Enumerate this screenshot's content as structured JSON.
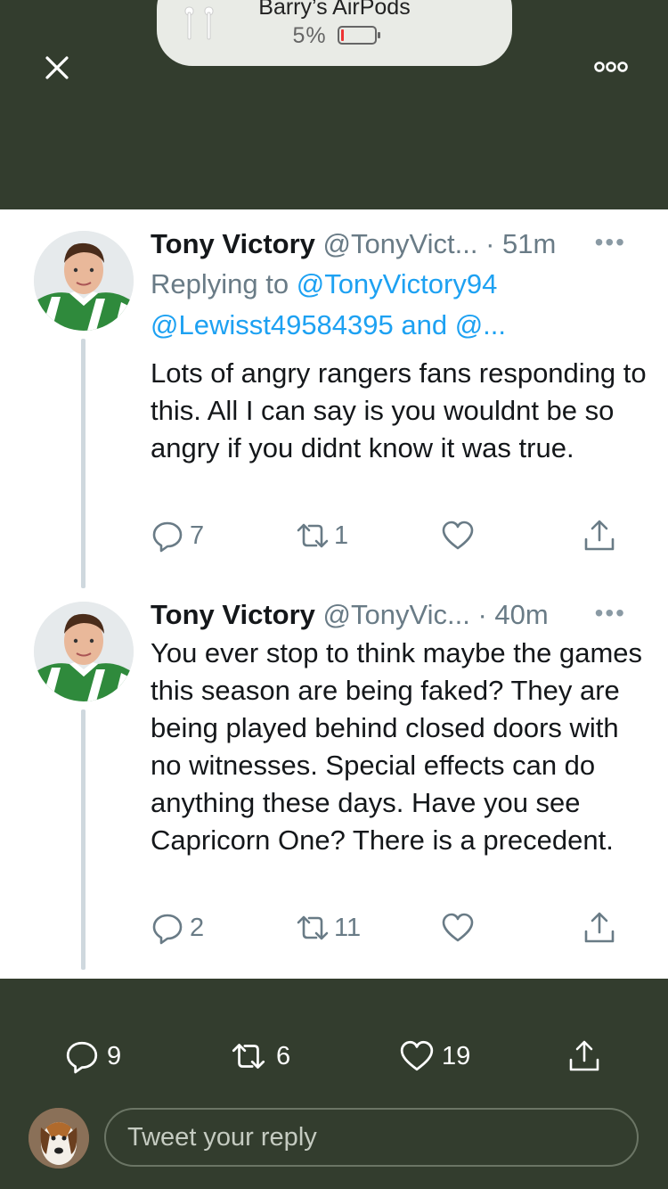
{
  "airpods": {
    "name": "Barry’s AirPods",
    "battery": "5%",
    "battery_level": 0.05
  },
  "tweets": [
    {
      "name": "Tony Victory",
      "handle": "@TonyVict...",
      "time": "· 51m",
      "replying_prefix": "Replying to ",
      "replying_to": "@TonyVictory94",
      "replying_line2": "@Lewisst49584395 and @...",
      "body": "Lots of angry rangers fans responding to this. All I can say is you wouldnt be so angry if you didnt know it was true.",
      "replies": "7",
      "retweets": "1"
    },
    {
      "name": "Tony Victory",
      "handle": "@TonyVic...",
      "time": "· 40m",
      "body": "You ever stop to think maybe the games this season are being faked? They are being played behind closed doors with no witnesses. Special effects can do anything these days. Have you see Capricorn One? There is a precedent.",
      "replies": "2",
      "retweets": "11"
    }
  ],
  "main_tweet_stats": {
    "replies": "9",
    "retweets": "6",
    "likes": "19"
  },
  "reply_box": {
    "placeholder": "Tweet your reply"
  },
  "colors": {
    "bar_bg": "#333d2e",
    "link": "#1da1f2",
    "muted": "#697b86",
    "text": "#14171a"
  },
  "icons": [
    "close-icon",
    "more-icon",
    "reply-icon",
    "retweet-icon",
    "like-icon",
    "share-icon",
    "airpods-icon"
  ]
}
